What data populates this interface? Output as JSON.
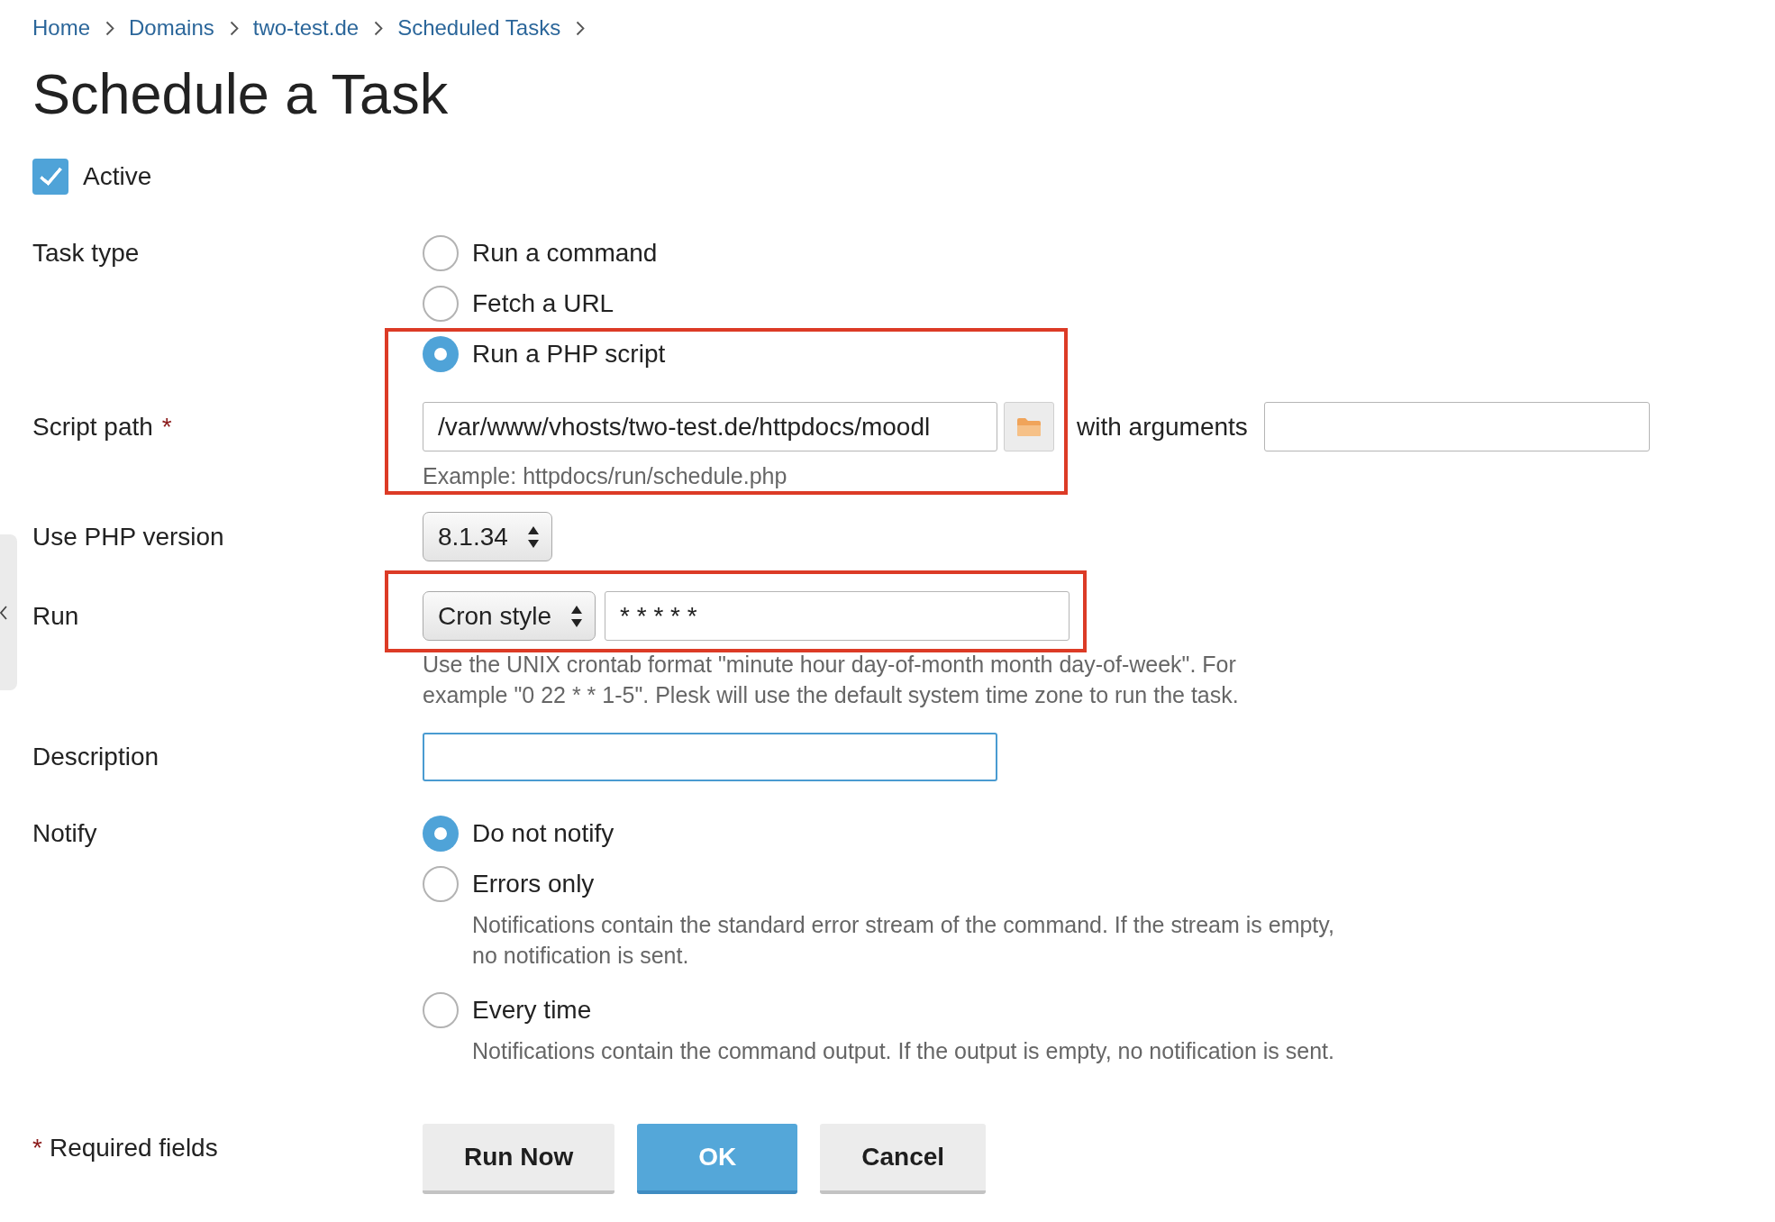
{
  "breadcrumbs": [
    {
      "label": "Home"
    },
    {
      "label": "Domains"
    },
    {
      "label": "two-test.de"
    },
    {
      "label": "Scheduled Tasks"
    }
  ],
  "title": "Schedule a Task",
  "active": {
    "label": "Active",
    "checked": true
  },
  "task_type": {
    "label": "Task type",
    "options": [
      {
        "label": "Run a command",
        "selected": false
      },
      {
        "label": "Fetch a URL",
        "selected": false
      },
      {
        "label": "Run a PHP script",
        "selected": true
      }
    ]
  },
  "script_path": {
    "label": "Script path",
    "required_mark": "*",
    "value": "/var/www/vhosts/two-test.de/httpdocs/moodl",
    "hint": "Example: httpdocs/run/schedule.php",
    "arguments_label": "with arguments",
    "highlighted": true
  },
  "php_version": {
    "label": "Use PHP version",
    "value": "8.1.34"
  },
  "run": {
    "label": "Run",
    "mode": "Cron style",
    "schedule": "* * * * *",
    "hint": "Use the UNIX crontab format \"minute hour day-of-month month day-of-week\". For example \"0 22 * * 1-5\". Plesk will use the default system time zone to run the task.",
    "highlighted": true
  },
  "description": {
    "label": "Description",
    "focused": true
  },
  "notify": {
    "label": "Notify",
    "options": [
      {
        "label": "Do not notify",
        "selected": true
      },
      {
        "label": "Errors only",
        "selected": false,
        "hint": "Notifications contain the standard error stream of the command. If the stream is empty, no notification is sent."
      },
      {
        "label": "Every time",
        "selected": false,
        "hint": "Notifications contain the command output. If the output is empty, no notification is sent."
      }
    ]
  },
  "footer": {
    "required_mark": "*",
    "required_text": "Required fields"
  },
  "buttons": [
    {
      "label": "Run Now",
      "kind": "default"
    },
    {
      "label": "OK",
      "kind": "primary"
    },
    {
      "label": "Cancel",
      "kind": "default"
    }
  ]
}
